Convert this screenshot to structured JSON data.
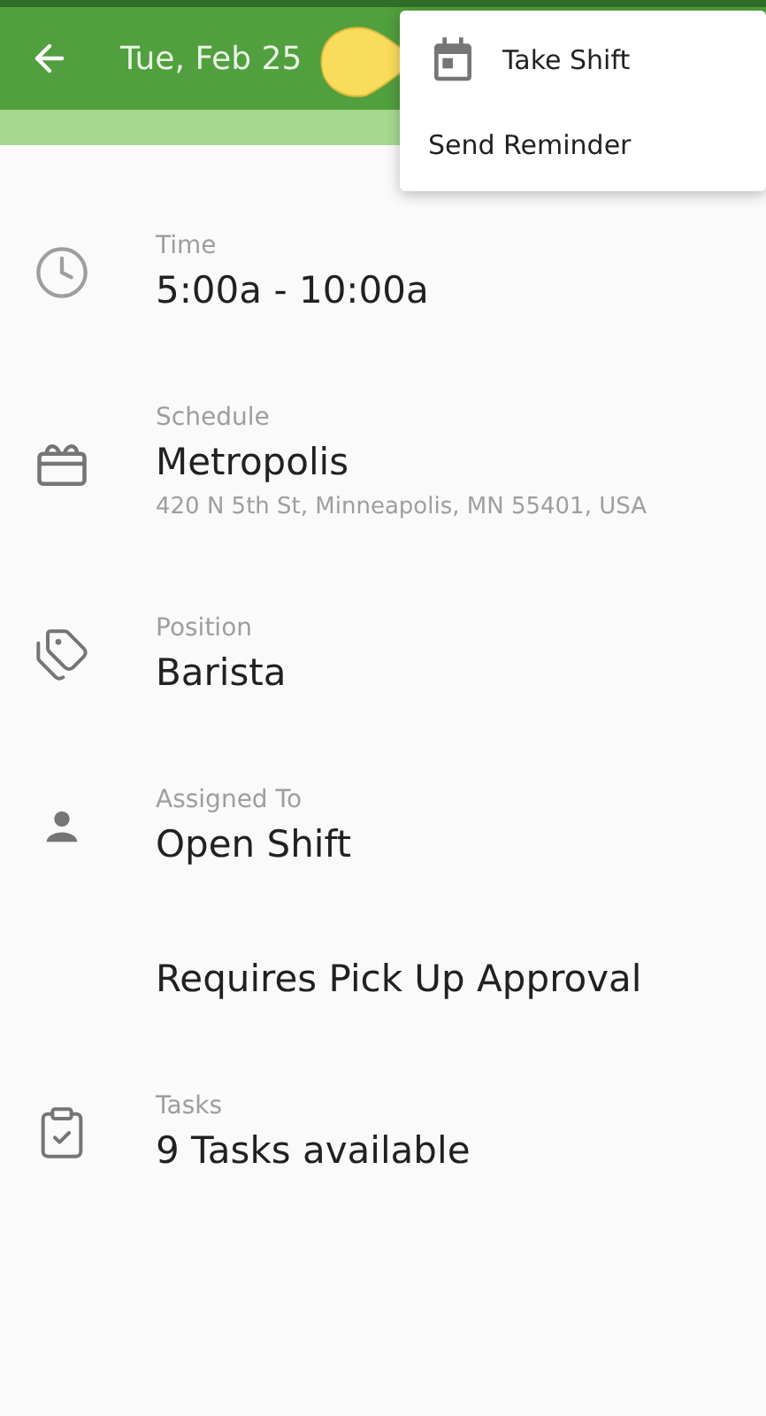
{
  "header": {
    "title": "Tue, Feb 25"
  },
  "menu": {
    "items": [
      {
        "label": "Take Shift",
        "kind": "with-icon"
      },
      {
        "label": "Send Reminder",
        "kind": "plain"
      }
    ]
  },
  "details": [
    {
      "kind": "time",
      "label": "Time",
      "value": "5:00a - 10:00a"
    },
    {
      "kind": "schedule",
      "label": "Schedule",
      "value": "Metropolis",
      "note": "420 N 5th St, Minneapolis, MN 55401, USA"
    },
    {
      "kind": "position",
      "label": "Position",
      "value": "Barista"
    },
    {
      "kind": "assignee",
      "label": "Assigned To",
      "value": "Open Shift"
    },
    {
      "kind": "plain",
      "value": "Requires Pick Up Approval"
    },
    {
      "kind": "tasks",
      "label": "Tasks",
      "value": "9 Tasks available"
    }
  ]
}
